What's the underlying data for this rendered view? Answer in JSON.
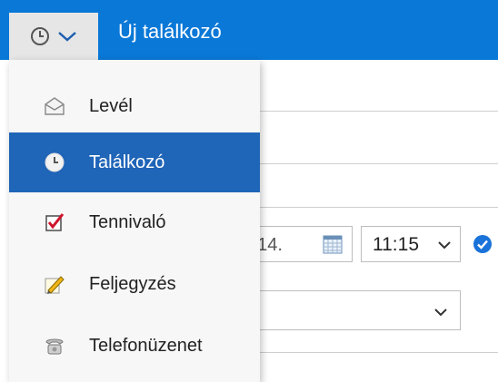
{
  "header": {
    "title": "Új találkozó",
    "type_icon": "clock-icon",
    "chevron_icon": "chevron-down-icon",
    "accent_color": "#0a78d7"
  },
  "menu": {
    "items": [
      {
        "label": "Levél",
        "icon": "envelope-icon",
        "selected": false
      },
      {
        "label": "Találkozó",
        "icon": "clock-icon",
        "selected": true
      },
      {
        "label": "Tennivaló",
        "icon": "checkbox-icon",
        "selected": false
      },
      {
        "label": "Feljegyzés",
        "icon": "pencil-note-icon",
        "selected": false
      },
      {
        "label": "Telefonüzenet",
        "icon": "telephone-icon",
        "selected": false
      }
    ],
    "selected_color": "#1f65b8"
  },
  "form": {
    "date_value": ". 14.",
    "time_value": "11:15",
    "status_icon": "check-circle-icon"
  }
}
